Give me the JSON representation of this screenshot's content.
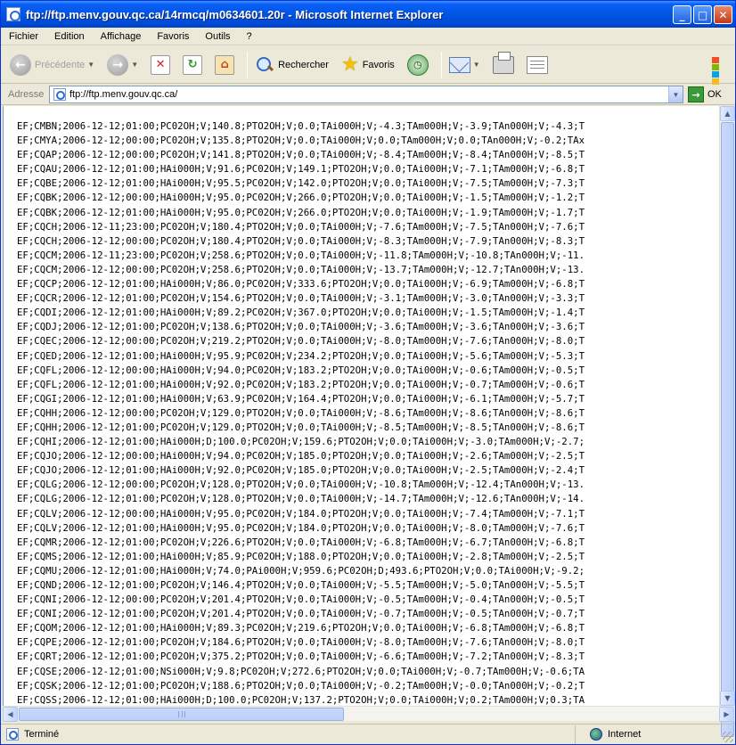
{
  "window": {
    "title": "ftp://ftp.menv.gouv.qc.ca/14rmcq/m0634601.20r - Microsoft Internet Explorer",
    "minimize": "_",
    "maximize": "□",
    "close": "✕"
  },
  "menu": [
    "Fichier",
    "Edition",
    "Affichage",
    "Favoris",
    "Outils",
    "?"
  ],
  "toolbar": {
    "back_label": "Précédente",
    "search_label": "Rechercher",
    "favorites_label": "Favoris"
  },
  "address": {
    "label": "Adresse",
    "url": "ftp://ftp.menv.gouv.qc.ca/",
    "go_label": "OK"
  },
  "content_lines": [
    "EF;CMBN;2006-12-12;01:00;PC02OH;V;140.8;PTO2OH;V;0.0;TAi000H;V;-4.3;TAm000H;V;-3.9;TAn000H;V;-4.3;T",
    "EF;CMYA;2006-12-12;00:00;PC02OH;V;135.8;PTO2OH;V;0.0;TAi000H;V;0.0;TAm000H;V;0.0;TAn000H;V;-0.2;TAx",
    "EF;CQAP;2006-12-12;00:00;PC02OH;V;141.8;PTO2OH;V;0.0;TAi000H;V;-8.4;TAm000H;V;-8.4;TAn000H;V;-8.5;T",
    "EF;CQAU;2006-12-12;01:00;HAi000H;V;91.6;PC02OH;V;149.1;PTO2OH;V;0.0;TAi000H;V;-7.1;TAm000H;V;-6.8;T",
    "EF;CQBE;2006-12-12;01:00;HAi000H;V;95.5;PC02OH;V;142.0;PTO2OH;V;0.0;TAi000H;V;-7.5;TAm000H;V;-7.3;T",
    "EF;CQBK;2006-12-12;00:00;HAi000H;V;95.0;PC02OH;V;266.0;PTO2OH;V;0.0;TAi000H;V;-1.5;TAm000H;V;-1.2;T",
    "EF;CQBK;2006-12-12;01:00;HAi000H;V;95.0;PC02OH;V;266.0;PTO2OH;V;0.0;TAi000H;V;-1.9;TAm000H;V;-1.7;T",
    "EF;CQCH;2006-12-11;23:00;PC02OH;V;180.4;PTO2OH;V;0.0;TAi000H;V;-7.6;TAm000H;V;-7.5;TAn000H;V;-7.6;T",
    "EF;CQCH;2006-12-12;00:00;PC02OH;V;180.4;PTO2OH;V;0.0;TAi000H;V;-8.3;TAm000H;V;-7.9;TAn000H;V;-8.3;T",
    "EF;CQCM;2006-12-11;23:00;PC02OH;V;258.6;PTO2OH;V;0.0;TAi000H;V;-11.8;TAm000H;V;-10.8;TAn000H;V;-11.",
    "EF;CQCM;2006-12-12;00:00;PC02OH;V;258.6;PTO2OH;V;0.0;TAi000H;V;-13.7;TAm000H;V;-12.7;TAn000H;V;-13.",
    "EF;CQCP;2006-12-12;01:00;HAi000H;V;86.0;PC02OH;V;333.6;PTO2OH;V;0.0;TAi000H;V;-6.9;TAm000H;V;-6.8;T",
    "EF;CQCR;2006-12-12;01:00;PC02OH;V;154.6;PTO2OH;V;0.0;TAi000H;V;-3.1;TAm000H;V;-3.0;TAn000H;V;-3.3;T",
    "EF;CQDI;2006-12-12;01:00;HAi000H;V;89.2;PC02OH;V;367.0;PTO2OH;V;0.0;TAi000H;V;-1.5;TAm000H;V;-1.4;T",
    "EF;CQDJ;2006-12-12;01:00;PC02OH;V;138.6;PTO2OH;V;0.0;TAi000H;V;-3.6;TAm000H;V;-3.6;TAn000H;V;-3.6;T",
    "EF;CQEC;2006-12-12;00:00;PC02OH;V;219.2;PTO2OH;V;0.0;TAi000H;V;-8.0;TAm000H;V;-7.6;TAn000H;V;-8.0;T",
    "EF;CQED;2006-12-12;01:00;HAi000H;V;95.9;PC02OH;V;234.2;PTO2OH;V;0.0;TAi000H;V;-5.6;TAm000H;V;-5.3;T",
    "EF;CQFL;2006-12-12;00:00;HAi000H;V;94.0;PC02OH;V;183.2;PTO2OH;V;0.0;TAi000H;V;-0.6;TAm000H;V;-0.5;T",
    "EF;CQFL;2006-12-12;01:00;HAi000H;V;92.0;PC02OH;V;183.2;PTO2OH;V;0.0;TAi000H;V;-0.7;TAm000H;V;-0.6;T",
    "EF;CQGI;2006-12-12;01:00;HAi000H;V;63.9;PC02OH;V;164.4;PTO2OH;V;0.0;TAi000H;V;-6.1;TAm000H;V;-5.7;T",
    "EF;CQHH;2006-12-12;00:00;PC02OH;V;129.0;PTO2OH;V;0.0;TAi000H;V;-8.6;TAm000H;V;-8.6;TAn000H;V;-8.6;T",
    "EF;CQHH;2006-12-12;01:00;PC02OH;V;129.0;PTO2OH;V;0.0;TAi000H;V;-8.5;TAm000H;V;-8.5;TAn000H;V;-8.6;T",
    "EF;CQHI;2006-12-12;01:00;HAi000H;D;100.0;PC02OH;V;159.6;PTO2OH;V;0.0;TAi000H;V;-3.0;TAm000H;V;-2.7;",
    "EF;CQJO;2006-12-12;00:00;HAi000H;V;94.0;PC02OH;V;185.0;PTO2OH;V;0.0;TAi000H;V;-2.6;TAm000H;V;-2.5;T",
    "EF;CQJO;2006-12-12;01:00;HAi000H;V;92.0;PC02OH;V;185.0;PTO2OH;V;0.0;TAi000H;V;-2.5;TAm000H;V;-2.4;T",
    "EF;CQLG;2006-12-12;00:00;PC02OH;V;128.0;PTO2OH;V;0.0;TAi000H;V;-10.8;TAm000H;V;-12.4;TAn000H;V;-13.",
    "EF;CQLG;2006-12-12;01:00;PC02OH;V;128.0;PTO2OH;V;0.0;TAi000H;V;-14.7;TAm000H;V;-12.6;TAn000H;V;-14.",
    "EF;CQLV;2006-12-12;00:00;HAi000H;V;95.0;PC02OH;V;184.0;PTO2OH;V;0.0;TAi000H;V;-7.4;TAm000H;V;-7.1;T",
    "EF;CQLV;2006-12-12;01:00;HAi000H;V;95.0;PC02OH;V;184.0;PTO2OH;V;0.0;TAi000H;V;-8.0;TAm000H;V;-7.6;T",
    "EF;CQMR;2006-12-12;01:00;PC02OH;V;226.6;PTO2OH;V;0.0;TAi000H;V;-6.8;TAm000H;V;-6.7;TAn000H;V;-6.8;T",
    "EF;CQMS;2006-12-12;01:00;HAi000H;V;85.9;PC02OH;V;188.0;PTO2OH;V;0.0;TAi000H;V;-2.8;TAm000H;V;-2.5;T",
    "EF;CQMU;2006-12-12;01:00;HAi000H;V;74.0;PAi000H;V;959.6;PC02OH;D;493.6;PTO2OH;V;0.0;TAi000H;V;-9.2;",
    "EF;CQND;2006-12-12;01:00;PC02OH;V;146.4;PTO2OH;V;0.0;TAi000H;V;-5.5;TAm000H;V;-5.0;TAn000H;V;-5.5;T",
    "EF;CQNI;2006-12-12;00:00;PC02OH;V;201.4;PTO2OH;V;0.0;TAi000H;V;-0.5;TAm000H;V;-0.4;TAn000H;V;-0.5;T",
    "EF;CQNI;2006-12-12;01:00;PC02OH;V;201.4;PTO2OH;V;0.0;TAi000H;V;-0.7;TAm000H;V;-0.5;TAn000H;V;-0.7;T",
    "EF;CQOM;2006-12-12;01:00;HAi000H;V;89.3;PC02OH;V;219.6;PTO2OH;V;0.0;TAi000H;V;-6.8;TAm000H;V;-6.8;T",
    "EF;CQPE;2006-12-12;01:00;PC02OH;V;184.6;PTO2OH;V;0.0;TAi000H;V;-8.0;TAm000H;V;-7.6;TAn000H;V;-8.0;T",
    "EF;CQRT;2006-12-12;01:00;PC02OH;V;375.2;PTO2OH;V;0.0;TAi000H;V;-6.6;TAm000H;V;-7.2;TAn000H;V;-8.3;T",
    "EF;CQSE;2006-12-12;01:00;NSi000H;V;9.8;PC02OH;V;272.6;PTO2OH;V;0.0;TAi000H;V;-0.7;TAm000H;V;-0.6;TA",
    "EF;CQSK;2006-12-12;01:00;PC02OH;V;188.6;PTO2OH;V;0.0;TAi000H;V;-0.2;TAm000H;V;-0.0;TAn000H;V;-0.2;T",
    "EF;CQSS;2006-12-12;01:00;HAi000H;D;100.0;PC02OH;V;137.2;PTO2OH;V;0.0;TAi000H;V;0.2;TAm000H;V;0.3;TA"
  ],
  "status": {
    "left": "Terminé",
    "zone": "Internet"
  },
  "colors": {
    "titlebar": "#0055e5",
    "chrome": "#ece9d8",
    "scrollbar_thumb": "#c1d3fb"
  }
}
